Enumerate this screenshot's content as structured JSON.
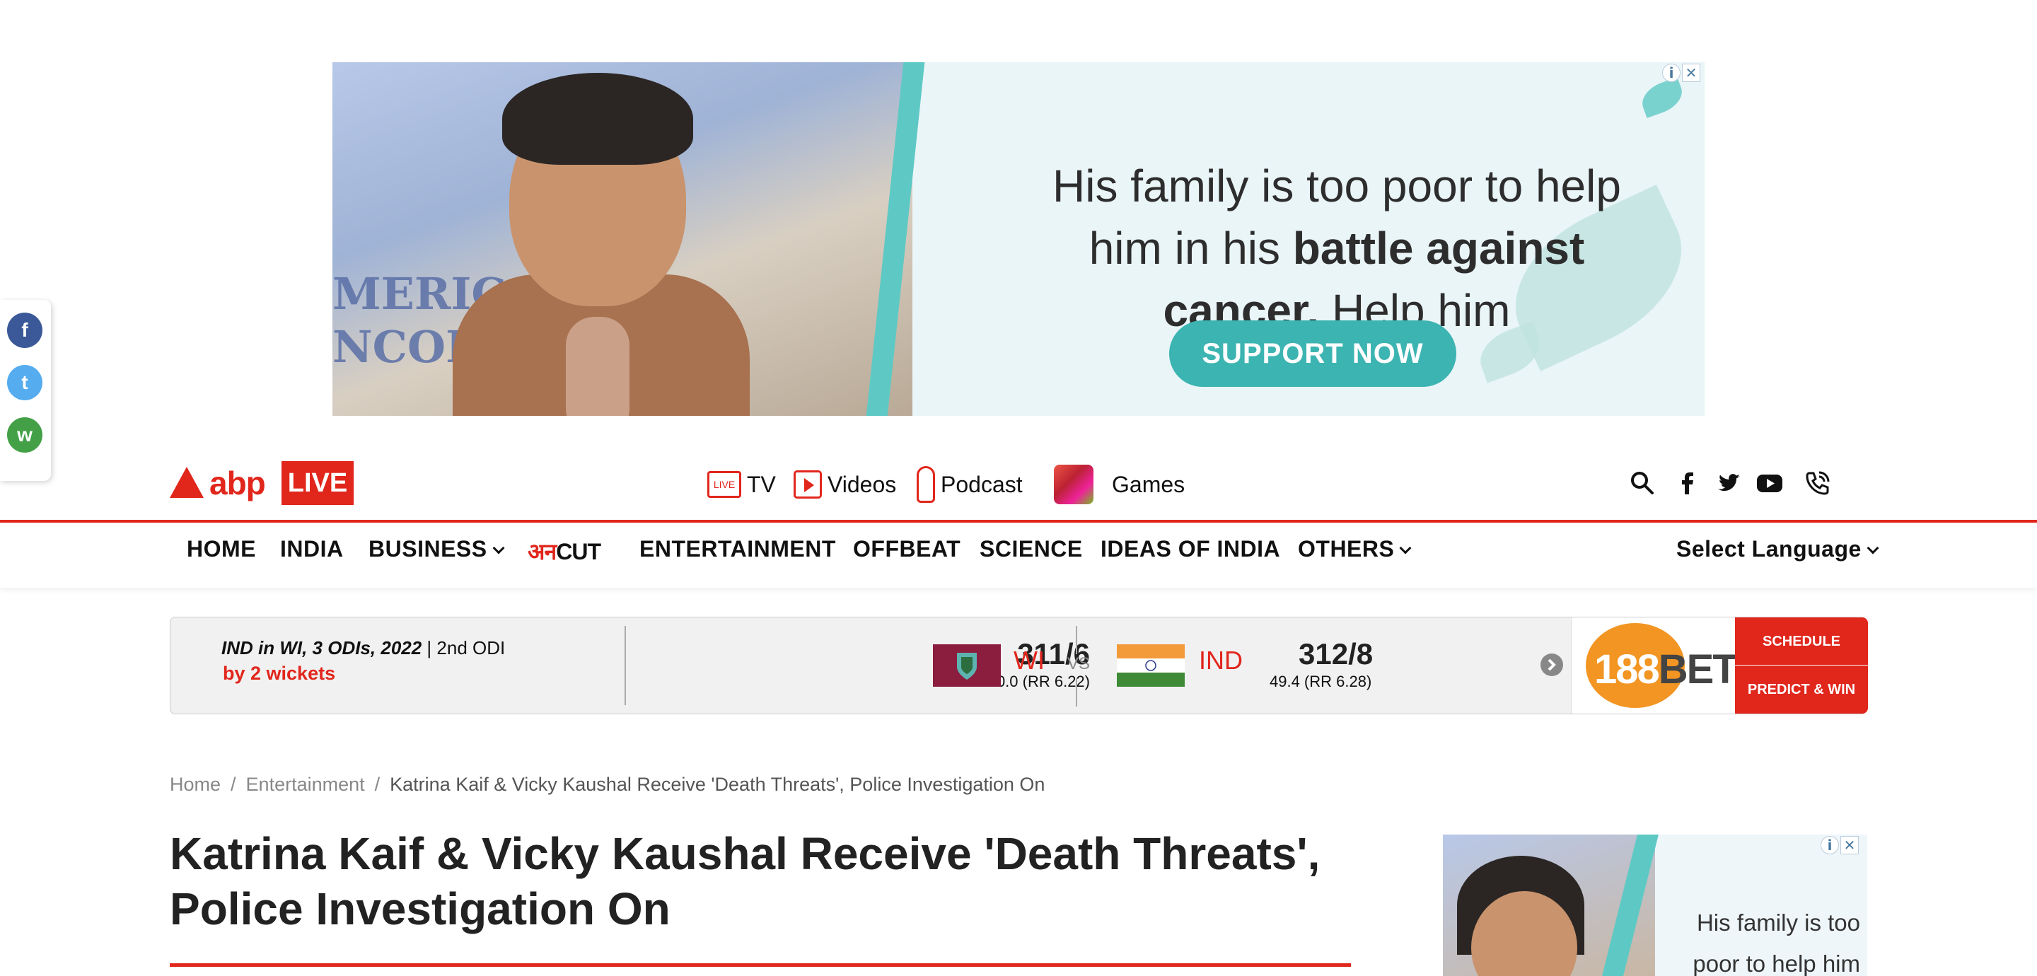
{
  "top_ad": {
    "line1": "His family is too poor to help",
    "line2_a": "him in his ",
    "line2_b": "battle against",
    "line3_a": "cancer.",
    "line3_b": " Help him",
    "button": "SUPPORT NOW",
    "hospital_text": "MERIC NCOL",
    "info_icon": "i",
    "close_icon": "✕"
  },
  "share": {
    "items": [
      {
        "name": "facebook-share-icon",
        "glyph": "f",
        "color": "#3b5998"
      },
      {
        "name": "twitter-share-icon",
        "glyph": "t",
        "color": "#55acee"
      },
      {
        "name": "whatsapp-share-icon",
        "glyph": "w",
        "color": "#43a047"
      }
    ]
  },
  "header": {
    "logo_abp": "abp",
    "logo_live": "LIVE",
    "tv_badge": "LIVE",
    "tv": "TV",
    "videos": "Videos",
    "podcast": "Podcast",
    "games": "Games",
    "icons": [
      "search-icon",
      "facebook-icon",
      "twitter-icon",
      "youtube-icon",
      "phone-icon"
    ]
  },
  "nav": {
    "home": "HOME",
    "india": "INDIA",
    "business": "BUSINESS",
    "anncut_a": "अन",
    "anncut_b": "CUT",
    "entertainment": "ENTERTAINMENT",
    "offbeat": "OFFBEAT",
    "science": "SCIENCE",
    "ideas": "IDEAS OF INDIA",
    "others": "OTHERS",
    "language": "Select Language"
  },
  "score": {
    "series": "IND in WI, 3 ODIs, 2022",
    "match": "2nd ODI",
    "result": "by 2 wickets",
    "team1": {
      "name": "WI",
      "score": "311/6",
      "overs": "50.0 (RR 6.22)"
    },
    "vs": "VS",
    "team2": {
      "name": "IND",
      "score": "312/8",
      "overs": "49.4 (RR 6.28)"
    },
    "sponsor_a": "188",
    "sponsor_b": "BET",
    "schedule": "SCHEDULE",
    "predict": "PREDICT & WIN"
  },
  "breadcrumb": {
    "home": "Home",
    "section": "Entertainment",
    "current": "Katrina Kaif & Vicky Kaushal Receive 'Death Threats', Police Investigation On"
  },
  "article": {
    "headline": "Katrina Kaif & Vicky Kaushal Receive 'Death Threats', Police Investigation On"
  },
  "side_ad": {
    "text": "His family is too poor to help him"
  },
  "colors": {
    "brand": "#e1261c",
    "teal": "#3cb4b1"
  }
}
